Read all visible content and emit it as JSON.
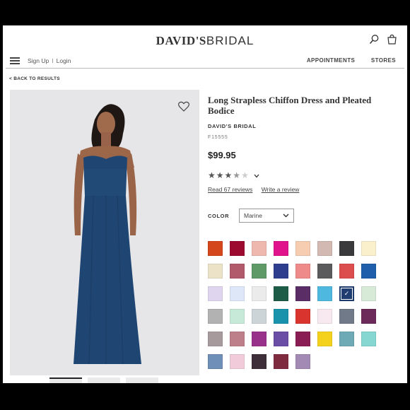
{
  "header": {
    "logo_bold": "DAVID'S",
    "logo_thin": "BRIDAL",
    "sign_up": "Sign Up",
    "login": "Login",
    "nav": [
      "APPOINTMENTS",
      "STORES"
    ]
  },
  "back_link": "< BACK TO RESULTS",
  "product": {
    "title": "Long Strapless Chiffon Dress and Pleated Bodice",
    "brand": "DAVID'S BRIDAL",
    "sku": "F15555",
    "price": "$99.95",
    "rating": 3.5,
    "reviews_link": "Read 67 reviews",
    "write_review": "Write a review",
    "color_label": "COLOR",
    "selected_color": "Marine"
  },
  "swatches": [
    "#d4471c",
    "#9c0b2f",
    "#efb8ae",
    "#e0138c",
    "#f6cdb0",
    "#d2b9b2",
    "#3a3a3c",
    "#fbf0cc",
    "#ece2c8",
    "#b05a6c",
    "#5e9a68",
    "#2f3d8f",
    "#ee8a8a",
    "#5b5b5e",
    "#dc4d4d",
    "#1e5eab",
    "#e0d5ef",
    "#dde7f7",
    "#ebebeb",
    "#1d5c46",
    "#5a2d67",
    "#4fb8df",
    "#1f3d70",
    "#d7e9d7",
    "#b2b2b2",
    "#c6ead7",
    "#ccd4d8",
    "#1993ac",
    "#d9342d",
    "#f8e8ef",
    "#707a88",
    "#6b2a59",
    "#a69a9c",
    "#bd7f8a",
    "#98318a",
    "#6a4da4",
    "#8a1e54",
    "#f4d21c",
    "#6ea9b6",
    "#86d6d1",
    "#6f8eb8",
    "#f1cbd9",
    "#3e2e39",
    "#7e2b3f",
    "#a38ab4"
  ],
  "selected_swatch_index": 22,
  "icons": [
    "search-icon",
    "bag-icon",
    "menu-icon",
    "heart-icon",
    "chevron-down-icon",
    "check-icon"
  ]
}
